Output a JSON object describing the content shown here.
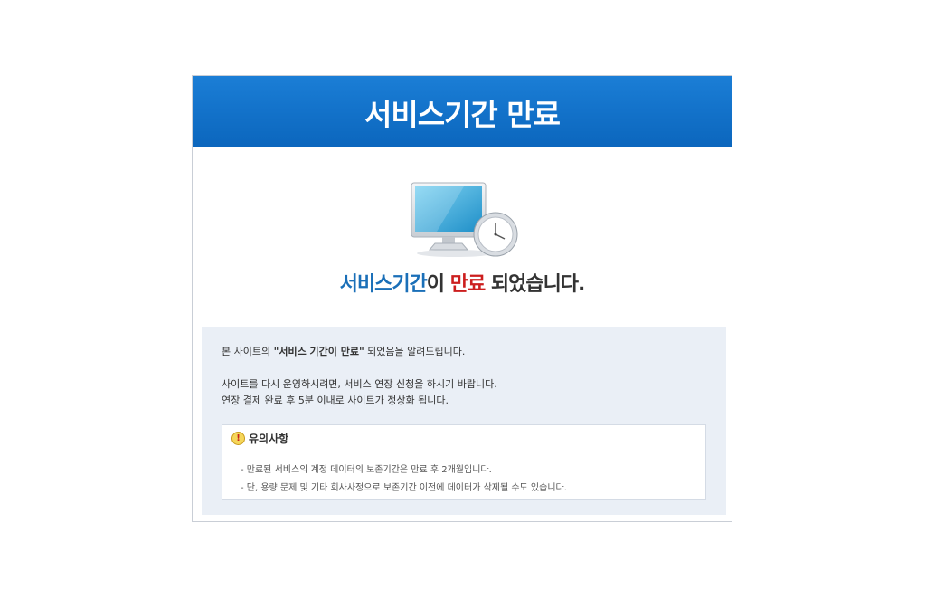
{
  "header": {
    "title": "서비스기간 만료"
  },
  "headline": {
    "part1": "서비스기간",
    "part2": "이 ",
    "part3": "만료",
    "part4": " 되었습니다."
  },
  "info": {
    "line1_pre": "본 사이트의 ",
    "line1_bold": "\"서비스 기간이 만료\"",
    "line1_post": " 되었음을 알려드립니다.",
    "line2": "사이트를 다시 운영하시려면, 서비스 연장 신청을 하시기 바랍니다.",
    "line3": "연장 결제 완료 후 5분 이내로 사이트가 정상화 됩니다."
  },
  "notice": {
    "title": "유의사항",
    "items": [
      "- 만료된 서비스의 계정 데이터의 보존기간은 만료 후 2개월입니다.",
      "- 단, 용량 문제 및 기타 회사사정으로 보존기간 이전에 데이터가 삭제될 수도 있습니다."
    ]
  },
  "colors": {
    "header_blue": "#0b66bd",
    "accent_blue": "#1a6fb8",
    "accent_red": "#cc1e1e",
    "info_bg": "#eaeff6"
  },
  "icons": [
    "monitor-clock-icon",
    "warning-icon"
  ]
}
